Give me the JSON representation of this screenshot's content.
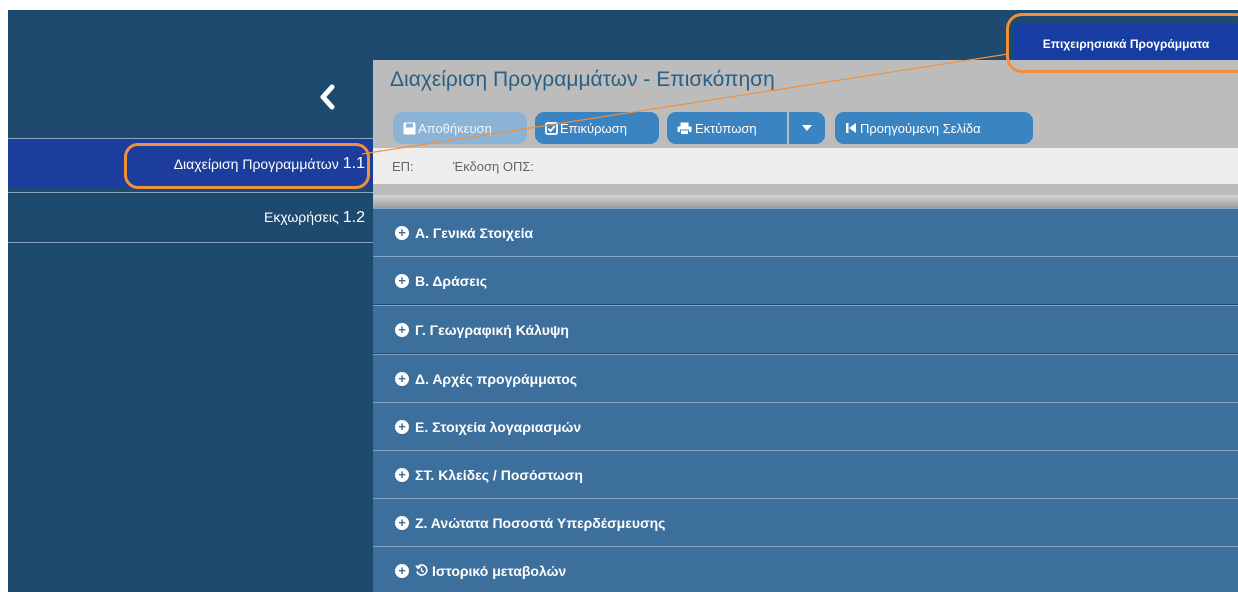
{
  "header": {
    "menu_label": "Επιχειρησιακά Προγράμματα"
  },
  "sidebar": {
    "collapse_icon": "chevron-left-icon",
    "items": [
      {
        "label": "Διαχείριση Προγραμμάτων",
        "number": "1.1",
        "active": true
      },
      {
        "label": "Εκχωρήσεις",
        "number": "1.2",
        "active": false
      }
    ]
  },
  "main": {
    "title": "Διαχείριση Προγραμμάτων - Επισκόπηση",
    "toolbar": {
      "save_label": "Αποθήκευση",
      "validate_label": "Επικύρωση",
      "print_label": "Εκτύπωση",
      "back_label": "Προηγούμενη Σελίδα"
    },
    "info": {
      "ep_label": "ΕΠ:",
      "version_label": "Έκδοση ΟΠΣ:"
    },
    "sections": [
      {
        "label": "Α. Γενικά Στοιχεία"
      },
      {
        "label": "Β. Δράσεις"
      },
      {
        "label": "Γ. Γεωγραφική Κάλυψη"
      },
      {
        "label": "Δ. Αρχές προγράμματος"
      },
      {
        "label": "Ε. Στοιχεία λογαριασμών"
      },
      {
        "label": "ΣΤ. Κλείδες / Ποσόστωση"
      },
      {
        "label": "Ζ. Ανώτατα Ποσοστά Υπερδέσμευσης"
      },
      {
        "label": "Ιστορικό μεταβολών"
      }
    ]
  },
  "colors": {
    "app_background": "#1d4a6e",
    "active_item": "#1c3d9b",
    "button": "#3a84c2",
    "accordion": "#3d6f9c",
    "callout": "#f0903a"
  }
}
